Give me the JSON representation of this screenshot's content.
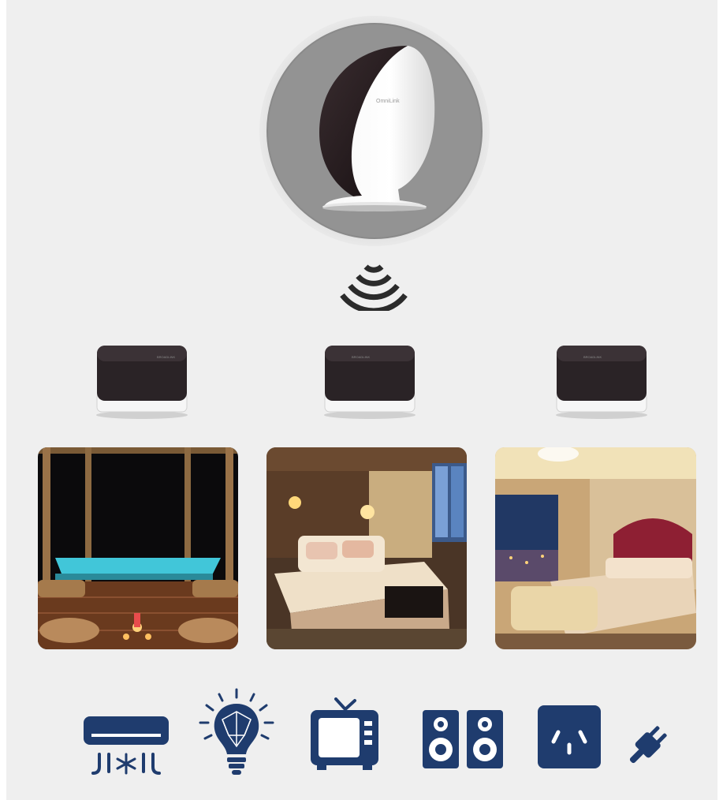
{
  "hub": {
    "brand_label": "OmniLink",
    "icon": "smart-hub-icon"
  },
  "wifi_icon": "wifi-signal-icon",
  "blasters": [
    {
      "icon": "ir-blaster-icon",
      "label": "BROADLINK"
    },
    {
      "icon": "ir-blaster-icon",
      "label": "BROADLINK"
    },
    {
      "icon": "ir-blaster-icon",
      "label": "BROADLINK"
    }
  ],
  "rooms": [
    {
      "scene": "pool-terrace-night"
    },
    {
      "scene": "hotel-bedroom-warm"
    },
    {
      "scene": "luxury-bedroom-city-view"
    }
  ],
  "appliances": [
    {
      "icon": "air-conditioner-icon"
    },
    {
      "icon": "smart-bulb-icon"
    },
    {
      "icon": "television-icon"
    },
    {
      "icon": "speakers-icon"
    },
    {
      "icon": "power-socket-icon"
    },
    {
      "icon": "plug-icon"
    }
  ],
  "colors": {
    "icon_navy": "#1f3c6e",
    "background": "#efefef",
    "blaster_body": "#2a2326"
  }
}
